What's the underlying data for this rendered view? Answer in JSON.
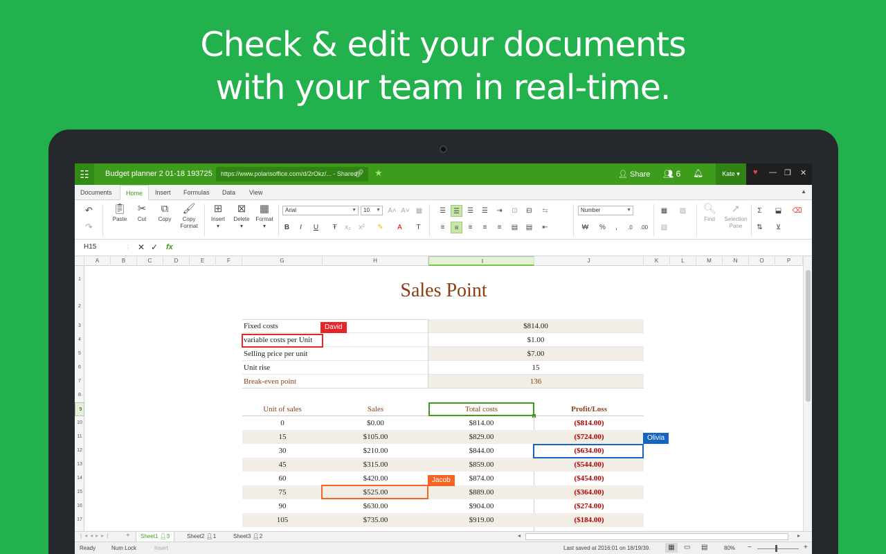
{
  "headline": {
    "line1": "Check & edit your documents",
    "line2": "with your team in real-time."
  },
  "titlebar": {
    "doc_title": "Budget planner 2 01-18 193725",
    "url": "https://www.polarisoffice.com/d/2rOkz/...",
    "shared": "- Shared",
    "share_label": "Share",
    "users_count": "6",
    "user_name": "Kate"
  },
  "menu": [
    "Documents",
    "Home",
    "Insert",
    "Formulas",
    "Data",
    "View"
  ],
  "ribbon": {
    "paste": "Paste",
    "cut": "Cut",
    "copy": "Copy",
    "copy_format_1": "Copy",
    "copy_format_2": "Format",
    "insert": "Insert",
    "delete": "Delete",
    "format": "Format",
    "font": "Arial",
    "font_size": "10",
    "number_format": "Number",
    "find": "Find",
    "selection_pane_1": "Selection",
    "selection_pane_2": "Pane"
  },
  "formula_bar": {
    "name_box": "H15",
    "fx": "fx"
  },
  "columns": [
    "A",
    "B",
    "C",
    "D",
    "E",
    "F",
    "G",
    "H",
    "I",
    "J",
    "K",
    "L",
    "M",
    "N",
    "O",
    "P"
  ],
  "rows": [
    "1",
    "2",
    "3",
    "4",
    "5",
    "6",
    "7",
    "8",
    "9",
    "10",
    "11",
    "12",
    "13",
    "14",
    "15",
    "16",
    "17"
  ],
  "sheet": {
    "title": "Sales Point",
    "summary": [
      {
        "label": "Fixed costs",
        "value": "$814.00"
      },
      {
        "label": "variable costs per Unit",
        "value": "$1.00"
      },
      {
        "label": "Selling price per unit",
        "value": "$7.00"
      },
      {
        "label": "Unit rise",
        "value": "15"
      },
      {
        "label": "Break-even point",
        "value": "136"
      }
    ],
    "table_headers": [
      "Unit of sales",
      "Sales",
      "Total costs",
      "Profit/Loss"
    ],
    "table_rows": [
      [
        "0",
        "$0.00",
        "$814.00",
        "($814.00)"
      ],
      [
        "15",
        "$105.00",
        "$829.00",
        "($724.00)"
      ],
      [
        "30",
        "$210.00",
        "$844.00",
        "($634.00)"
      ],
      [
        "45",
        "$315.00",
        "$859.00",
        "($544.00)"
      ],
      [
        "60",
        "$420.00",
        "$874.00",
        "($454.00)"
      ],
      [
        "75",
        "$525.00",
        "$889.00",
        "($364.00)"
      ],
      [
        "90",
        "$630.00",
        "$904.00",
        "($274.00)"
      ],
      [
        "105",
        "$735.00",
        "$919.00",
        "($184.00)"
      ]
    ]
  },
  "collaborators": [
    {
      "name": "David",
      "color": "#e8242b"
    },
    {
      "name": "Olivia",
      "color": "#1565c0"
    },
    {
      "name": "Jacob",
      "color": "#f26522"
    }
  ],
  "sheets": [
    {
      "name": "Sheet1",
      "users": "3"
    },
    {
      "name": "Sheet2",
      "users": "1"
    },
    {
      "name": "Sheet3",
      "users": "2"
    }
  ],
  "status": {
    "ready": "Ready",
    "numlock": "Num Lock",
    "insert": "Insert",
    "last_saved": "Last saved at 2016:01 on 18/19/39.",
    "zoom": "80%"
  },
  "colors": {
    "brand_green": "#3d9c1c",
    "background": "#22b14c",
    "accent_brown": "#8b3d10",
    "loss_red": "#b00000"
  }
}
